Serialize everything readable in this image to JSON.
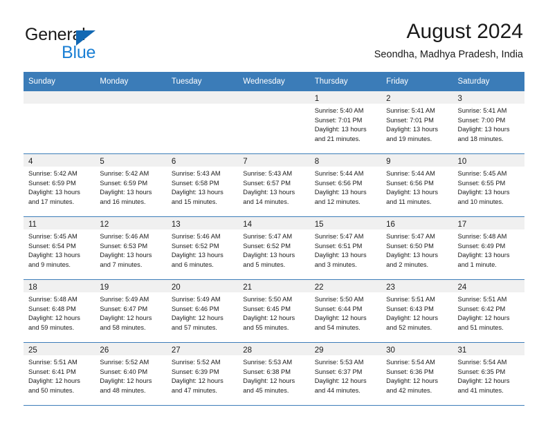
{
  "brand": {
    "name_part1": "General",
    "name_part2": "Blue",
    "triangle_color": "#1268b3",
    "blue_color": "#1a7fd4"
  },
  "header": {
    "title": "August 2024",
    "subtitle": "Seondha, Madhya Pradesh, India"
  },
  "colors": {
    "header_row": "#3b7cb8",
    "daynum_band": "#f0f0f0",
    "grid_line": "#3b7cb8"
  },
  "weekdays": [
    "Sunday",
    "Monday",
    "Tuesday",
    "Wednesday",
    "Thursday",
    "Friday",
    "Saturday"
  ],
  "weeks": [
    [
      {
        "day": "",
        "lines": []
      },
      {
        "day": "",
        "lines": []
      },
      {
        "day": "",
        "lines": []
      },
      {
        "day": "",
        "lines": []
      },
      {
        "day": "1",
        "lines": [
          "Sunrise: 5:40 AM",
          "Sunset: 7:01 PM",
          "Daylight: 13 hours",
          "and 21 minutes."
        ]
      },
      {
        "day": "2",
        "lines": [
          "Sunrise: 5:41 AM",
          "Sunset: 7:01 PM",
          "Daylight: 13 hours",
          "and 19 minutes."
        ]
      },
      {
        "day": "3",
        "lines": [
          "Sunrise: 5:41 AM",
          "Sunset: 7:00 PM",
          "Daylight: 13 hours",
          "and 18 minutes."
        ]
      }
    ],
    [
      {
        "day": "4",
        "lines": [
          "Sunrise: 5:42 AM",
          "Sunset: 6:59 PM",
          "Daylight: 13 hours",
          "and 17 minutes."
        ]
      },
      {
        "day": "5",
        "lines": [
          "Sunrise: 5:42 AM",
          "Sunset: 6:59 PM",
          "Daylight: 13 hours",
          "and 16 minutes."
        ]
      },
      {
        "day": "6",
        "lines": [
          "Sunrise: 5:43 AM",
          "Sunset: 6:58 PM",
          "Daylight: 13 hours",
          "and 15 minutes."
        ]
      },
      {
        "day": "7",
        "lines": [
          "Sunrise: 5:43 AM",
          "Sunset: 6:57 PM",
          "Daylight: 13 hours",
          "and 14 minutes."
        ]
      },
      {
        "day": "8",
        "lines": [
          "Sunrise: 5:44 AM",
          "Sunset: 6:56 PM",
          "Daylight: 13 hours",
          "and 12 minutes."
        ]
      },
      {
        "day": "9",
        "lines": [
          "Sunrise: 5:44 AM",
          "Sunset: 6:56 PM",
          "Daylight: 13 hours",
          "and 11 minutes."
        ]
      },
      {
        "day": "10",
        "lines": [
          "Sunrise: 5:45 AM",
          "Sunset: 6:55 PM",
          "Daylight: 13 hours",
          "and 10 minutes."
        ]
      }
    ],
    [
      {
        "day": "11",
        "lines": [
          "Sunrise: 5:45 AM",
          "Sunset: 6:54 PM",
          "Daylight: 13 hours",
          "and 9 minutes."
        ]
      },
      {
        "day": "12",
        "lines": [
          "Sunrise: 5:46 AM",
          "Sunset: 6:53 PM",
          "Daylight: 13 hours",
          "and 7 minutes."
        ]
      },
      {
        "day": "13",
        "lines": [
          "Sunrise: 5:46 AM",
          "Sunset: 6:52 PM",
          "Daylight: 13 hours",
          "and 6 minutes."
        ]
      },
      {
        "day": "14",
        "lines": [
          "Sunrise: 5:47 AM",
          "Sunset: 6:52 PM",
          "Daylight: 13 hours",
          "and 5 minutes."
        ]
      },
      {
        "day": "15",
        "lines": [
          "Sunrise: 5:47 AM",
          "Sunset: 6:51 PM",
          "Daylight: 13 hours",
          "and 3 minutes."
        ]
      },
      {
        "day": "16",
        "lines": [
          "Sunrise: 5:47 AM",
          "Sunset: 6:50 PM",
          "Daylight: 13 hours",
          "and 2 minutes."
        ]
      },
      {
        "day": "17",
        "lines": [
          "Sunrise: 5:48 AM",
          "Sunset: 6:49 PM",
          "Daylight: 13 hours",
          "and 1 minute."
        ]
      }
    ],
    [
      {
        "day": "18",
        "lines": [
          "Sunrise: 5:48 AM",
          "Sunset: 6:48 PM",
          "Daylight: 12 hours",
          "and 59 minutes."
        ]
      },
      {
        "day": "19",
        "lines": [
          "Sunrise: 5:49 AM",
          "Sunset: 6:47 PM",
          "Daylight: 12 hours",
          "and 58 minutes."
        ]
      },
      {
        "day": "20",
        "lines": [
          "Sunrise: 5:49 AM",
          "Sunset: 6:46 PM",
          "Daylight: 12 hours",
          "and 57 minutes."
        ]
      },
      {
        "day": "21",
        "lines": [
          "Sunrise: 5:50 AM",
          "Sunset: 6:45 PM",
          "Daylight: 12 hours",
          "and 55 minutes."
        ]
      },
      {
        "day": "22",
        "lines": [
          "Sunrise: 5:50 AM",
          "Sunset: 6:44 PM",
          "Daylight: 12 hours",
          "and 54 minutes."
        ]
      },
      {
        "day": "23",
        "lines": [
          "Sunrise: 5:51 AM",
          "Sunset: 6:43 PM",
          "Daylight: 12 hours",
          "and 52 minutes."
        ]
      },
      {
        "day": "24",
        "lines": [
          "Sunrise: 5:51 AM",
          "Sunset: 6:42 PM",
          "Daylight: 12 hours",
          "and 51 minutes."
        ]
      }
    ],
    [
      {
        "day": "25",
        "lines": [
          "Sunrise: 5:51 AM",
          "Sunset: 6:41 PM",
          "Daylight: 12 hours",
          "and 50 minutes."
        ]
      },
      {
        "day": "26",
        "lines": [
          "Sunrise: 5:52 AM",
          "Sunset: 6:40 PM",
          "Daylight: 12 hours",
          "and 48 minutes."
        ]
      },
      {
        "day": "27",
        "lines": [
          "Sunrise: 5:52 AM",
          "Sunset: 6:39 PM",
          "Daylight: 12 hours",
          "and 47 minutes."
        ]
      },
      {
        "day": "28",
        "lines": [
          "Sunrise: 5:53 AM",
          "Sunset: 6:38 PM",
          "Daylight: 12 hours",
          "and 45 minutes."
        ]
      },
      {
        "day": "29",
        "lines": [
          "Sunrise: 5:53 AM",
          "Sunset: 6:37 PM",
          "Daylight: 12 hours",
          "and 44 minutes."
        ]
      },
      {
        "day": "30",
        "lines": [
          "Sunrise: 5:54 AM",
          "Sunset: 6:36 PM",
          "Daylight: 12 hours",
          "and 42 minutes."
        ]
      },
      {
        "day": "31",
        "lines": [
          "Sunrise: 5:54 AM",
          "Sunset: 6:35 PM",
          "Daylight: 12 hours",
          "and 41 minutes."
        ]
      }
    ]
  ]
}
